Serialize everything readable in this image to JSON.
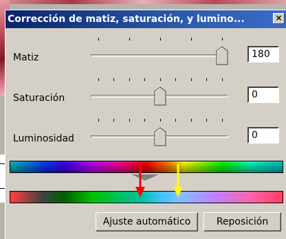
{
  "dialog": {
    "title": "Corrección de matiz, saturación, y lumino...",
    "close_label": "×"
  },
  "sliders": [
    {
      "label": "Matiz",
      "value": "180"
    },
    {
      "label": "Saturación",
      "value": "0"
    },
    {
      "label": "Luminosidad",
      "value": "0"
    }
  ],
  "buttons": {
    "auto": "Ajuste automático",
    "reset": "Reposición"
  },
  "colors": {
    "titlebar": "#0a246a",
    "red_arrow": "#ff0000",
    "yellow_arrow": "#ffff00",
    "face": "#d4d0c8"
  }
}
